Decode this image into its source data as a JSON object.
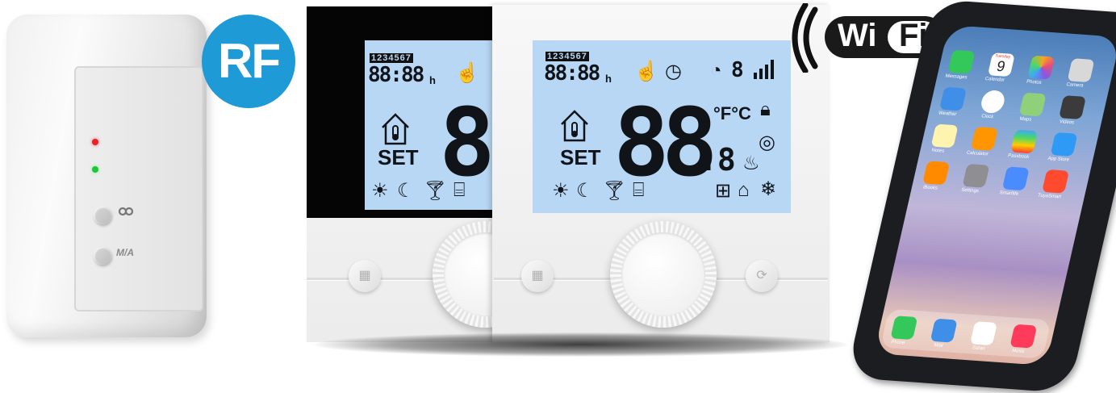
{
  "receiver": {
    "badge": "RF",
    "button_label": "M/A"
  },
  "thermostat_back": {
    "days": "1234567",
    "time": "88:88",
    "time_suffix": "h",
    "set_label": "SET",
    "digits": "8"
  },
  "thermostat_front": {
    "days": "1234567",
    "time": "88:88",
    "time_suffix": "h",
    "set_label": "SET",
    "digits": "88",
    "decimal": ".8",
    "unit": "°F°C",
    "timer_digit": "8"
  },
  "wifi_badge": {
    "wi": "Wi",
    "fi": "Fi"
  },
  "phone": {
    "apps": [
      "Messages",
      "Calendar",
      "Photos",
      "Camera",
      "Weather",
      "Clock",
      "Maps",
      "Videos",
      "Notes",
      "Calculator",
      "Passbook",
      "App Store",
      "iBooks",
      "Settings",
      "Smartlife",
      "TuyaSmart"
    ],
    "calendar_day": "Tuesday",
    "calendar_date": "9",
    "dock": [
      "Phone",
      "Mail",
      "Safari",
      "Music"
    ]
  },
  "colors": {
    "rf_badge": "#1e9ad6",
    "lcd": "#b8d7f5",
    "led_red": "#e8202a",
    "led_green": "#20c43a"
  }
}
